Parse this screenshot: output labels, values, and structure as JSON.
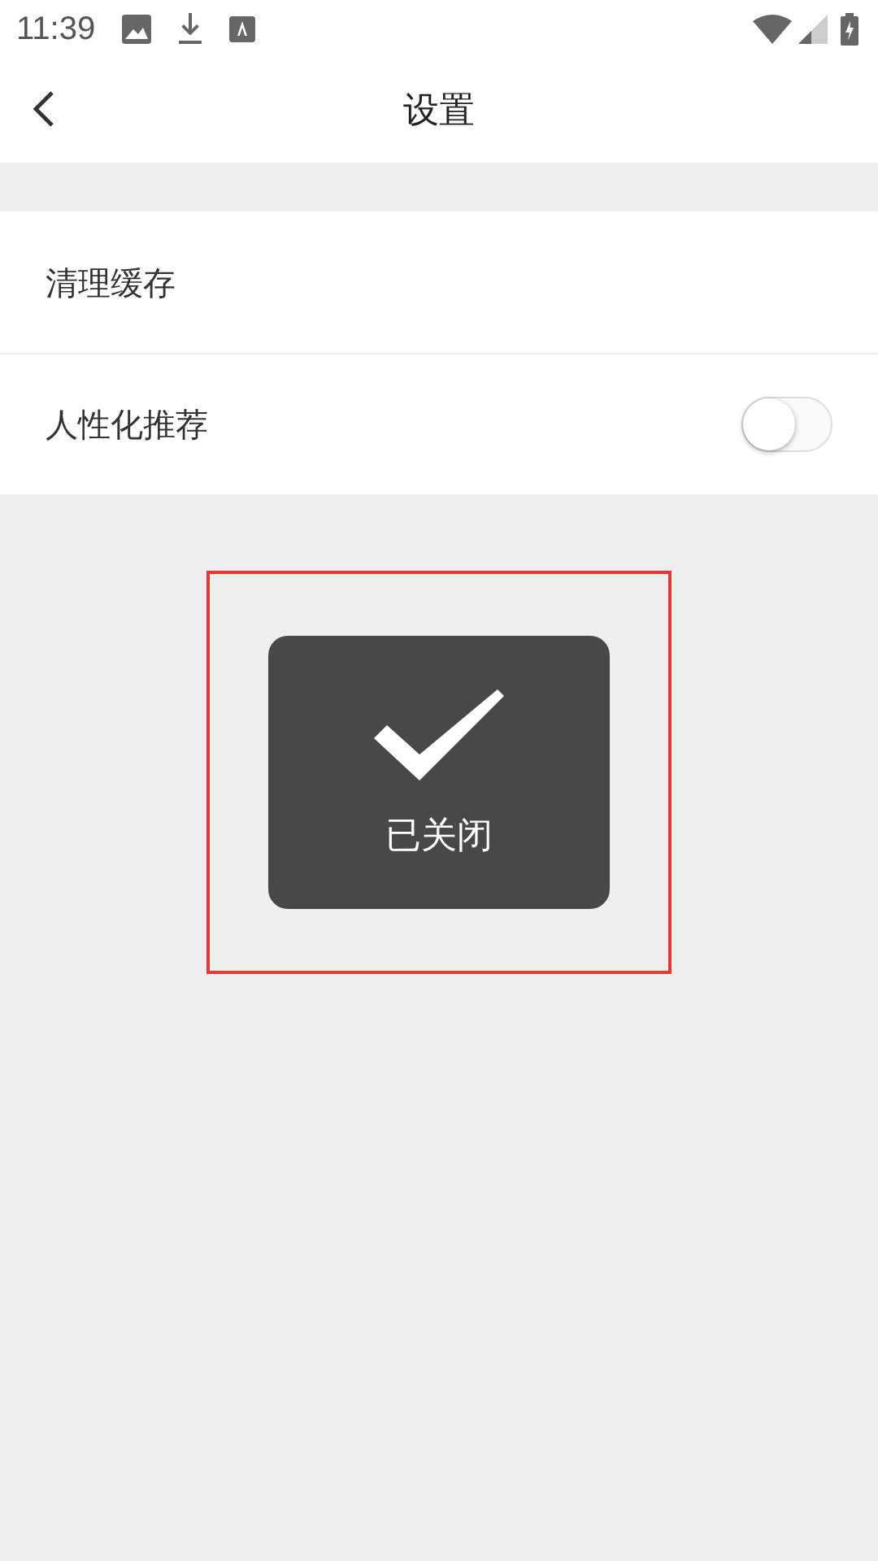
{
  "status_bar": {
    "time": "11:39"
  },
  "header": {
    "title": "设置"
  },
  "settings": [
    {
      "kind": "link",
      "label": "清理缓存"
    },
    {
      "kind": "toggle",
      "label": "人性化推荐",
      "on": false
    }
  ],
  "toast": {
    "message": "已关闭",
    "highlighted": true
  }
}
